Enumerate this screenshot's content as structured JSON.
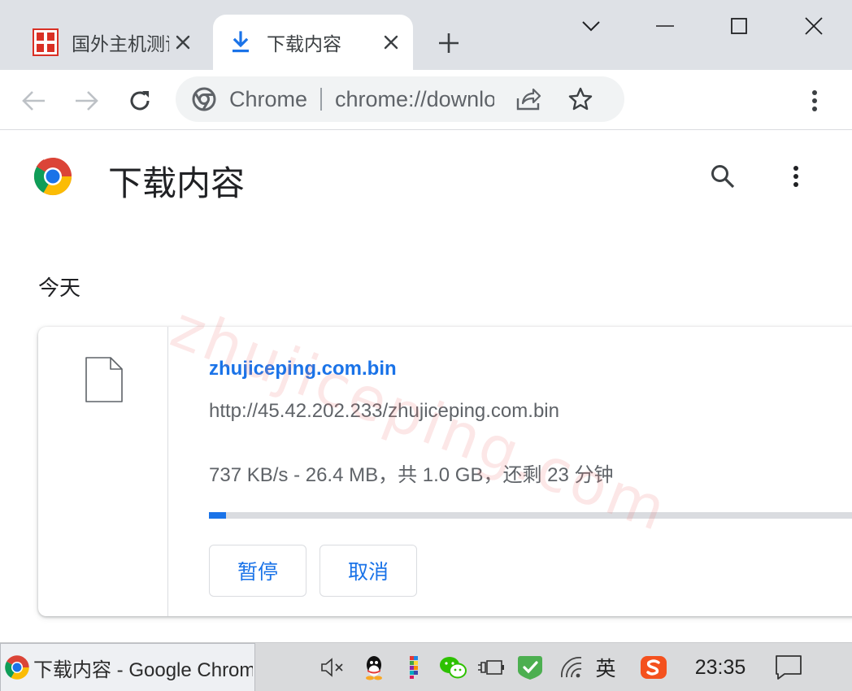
{
  "tabs": [
    {
      "title": "国外主机测评",
      "active": false,
      "favicon": "seal-favicon-icon"
    },
    {
      "title": "下载内容",
      "active": true,
      "favicon": "download-icon"
    }
  ],
  "toolbar": {
    "omnibox_chip": "Chrome",
    "omnibox_url": "chrome://downloads"
  },
  "page": {
    "title": "下载内容",
    "section_date": "今天"
  },
  "download": {
    "file_name": "zhujiceping.com.bin",
    "source_url": "http://45.42.202.233/zhujiceping.com.bin",
    "status": "737 KB/s - 26.4 MB，共 1.0 GB，还剩 23 分钟",
    "progress": 0.0258,
    "pause_label": "暂停",
    "cancel_label": "取消"
  },
  "watermark": "zhujiceping.com",
  "taskbar": {
    "app_title": "下载内容 - Google Chrome",
    "ime_label": "英",
    "clock": "23:35"
  },
  "colors": {
    "accent": "#1a73e8",
    "tabstrip": "#dee1e6",
    "taskbar": "#d9dadc"
  }
}
